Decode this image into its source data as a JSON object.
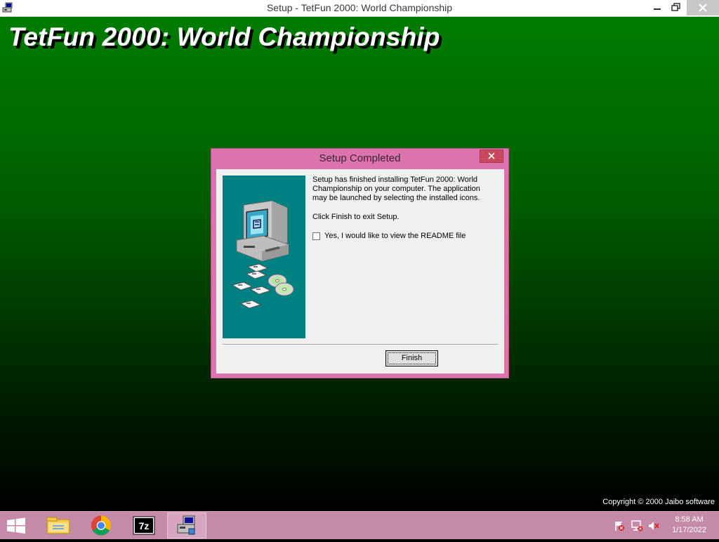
{
  "window": {
    "title": "Setup - TetFun 2000: World Championship",
    "controls": [
      "minimize",
      "restore",
      "close"
    ]
  },
  "setup_screen": {
    "title": "TetFun 2000: World Championship",
    "copyright": "Copyright © 2000 Jaibo software",
    "background_colors": [
      "#007c00",
      "#000000"
    ]
  },
  "dialog": {
    "title": "Setup Completed",
    "message": "Setup has finished installing TetFun 2000: World Championship on your computer. The application may be launched by selecting the installed icons.",
    "instruction": "Click Finish to exit Setup.",
    "readme_checkbox": {
      "label": "Yes, I would like to view the README file",
      "checked": false
    },
    "finish_label": "Finish",
    "side_image": "computer-with-disks-icon",
    "frame_color": "#dc73ac"
  },
  "taskbar": {
    "items": [
      "windows-start-icon",
      "file-explorer-icon",
      "chrome-icon",
      "7zip-icon",
      "setup-icon"
    ],
    "active_item": "setup-icon",
    "tray_icons": [
      "action-center-flag-icon",
      "network-icon",
      "volume-muted-icon"
    ],
    "time": "8:58 AM",
    "date": "1/17/2022",
    "color": "#c58aa8"
  }
}
